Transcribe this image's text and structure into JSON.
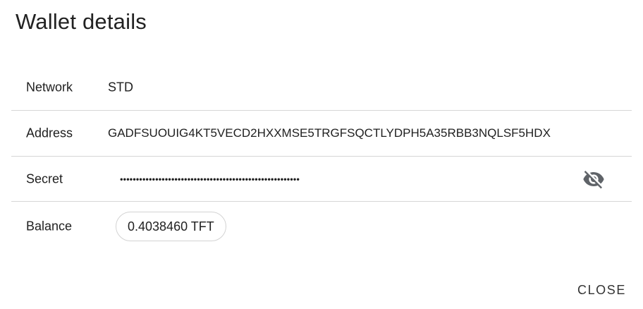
{
  "dialog": {
    "title": "Wallet details",
    "close_label": "CLOSE"
  },
  "details": {
    "network": {
      "label": "Network",
      "value": "STD"
    },
    "address": {
      "label": "Address",
      "value": "GADFSUOUIG4KT5VECD2HXXMSE5TRGFSQCTLYDPH5A35RBB3NQLSF5HDX"
    },
    "secret": {
      "label": "Secret",
      "value": "••••••••••••••••••••••••••••••••••••••••••••••••••••••••",
      "toggle_icon": "eye-off-icon"
    },
    "balance": {
      "label": "Balance",
      "value": "0.4038460 TFT"
    }
  }
}
